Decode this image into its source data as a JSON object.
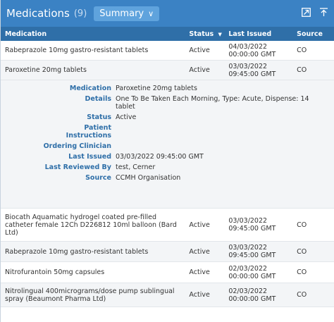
{
  "header": {
    "title": "Medications",
    "count": "(9)",
    "summary_label": "Summary",
    "colors": {
      "title_bar": "#3b82c4",
      "header_row": "#2f6fa8",
      "label_blue": "#2f6fa8"
    }
  },
  "columns": {
    "medication": "Medication",
    "status": "Status",
    "sort_icon": "▼",
    "last_issued": "Last Issued",
    "source": "Source"
  },
  "rows_top": [
    {
      "medication": "Rabeprazole 10mg gastro-resistant tablets",
      "status": "Active",
      "issued_date": "04/03/2022",
      "issued_time": "00:00:00 GMT",
      "source": "CO"
    },
    {
      "medication": "Paroxetine 20mg tablets",
      "status": "Active",
      "issued_date": "03/03/2022",
      "issued_time": "09:45:00 GMT",
      "source": "CO"
    }
  ],
  "detail": {
    "medication_label": "Medication",
    "medication_value": "Paroxetine 20mg tablets",
    "details_label": "Details",
    "details_value": "One To Be Taken Each Morning, Type: Acute, Dispense: 14 tablet",
    "status_label": "Status",
    "status_value": "Active",
    "patient_label_1": "Patient",
    "patient_label_2": "Instructions",
    "clinician_label": "Ordering Clinician",
    "last_issued_label": "Last Issued",
    "last_issued_value": "03/03/2022 09:45:00 GMT",
    "reviewed_label": "Last Reviewed By",
    "reviewed_value": "test, Cerner",
    "source_label": "Source",
    "source_value": "CCMH Organisation"
  },
  "rows_bottom": [
    {
      "medication": "Biocath Aquamatic hydrogel coated pre-filled catheter female 12Ch D226812 10ml balloon (Bard Ltd)",
      "status": "Active",
      "issued_date": "03/03/2022",
      "issued_time": "09:45:00 GMT",
      "source": "CO"
    },
    {
      "medication": "Rabeprazole 10mg gastro-resistant tablets",
      "status": "Active",
      "issued_date": "03/03/2022",
      "issued_time": "09:45:00 GMT",
      "source": "CO"
    },
    {
      "medication": "Nitrofurantoin 50mg capsules",
      "status": "Active",
      "issued_date": "02/03/2022",
      "issued_time": "00:00:00 GMT",
      "source": "CO"
    },
    {
      "medication": "Nitrolingual 400micrograms/dose pump sublingual spray (Beaumont Pharma Ltd)",
      "status": "Active",
      "issued_date": "02/03/2022",
      "issued_time": "00:00:00 GMT",
      "source": "CO"
    }
  ]
}
